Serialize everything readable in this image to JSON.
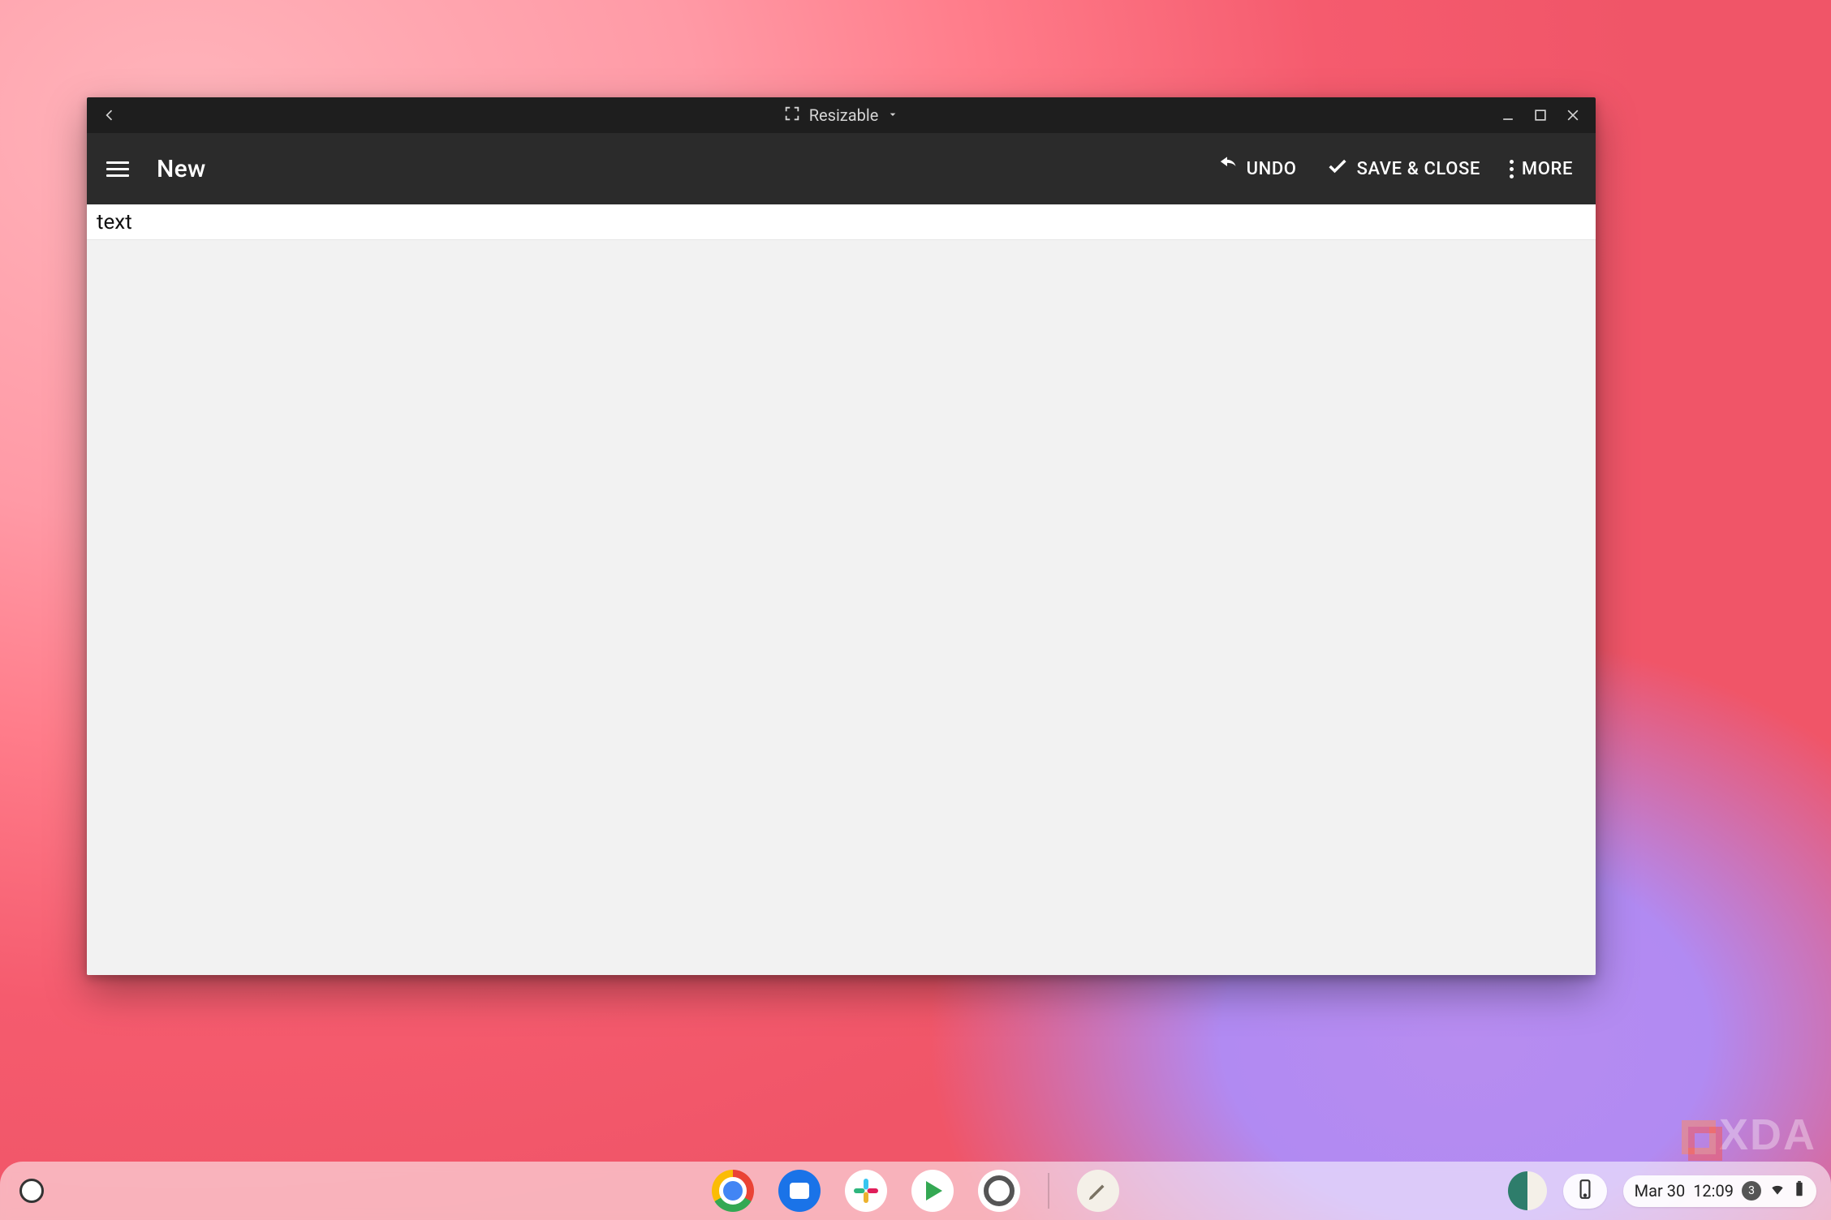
{
  "window": {
    "titlebar": {
      "resizable_label": "Resizable"
    },
    "toolbar": {
      "title": "New",
      "undo_label": "UNDO",
      "save_close_label": "SAVE & CLOSE",
      "more_label": "MORE"
    },
    "editor": {
      "first_line": "text"
    }
  },
  "shelf": {
    "apps": [
      {
        "name": "chrome"
      },
      {
        "name": "files"
      },
      {
        "name": "slack"
      },
      {
        "name": "play-store"
      },
      {
        "name": "settings"
      },
      {
        "name": "text-editor"
      }
    ],
    "status": {
      "date": "Mar 30",
      "time": "12:09",
      "notification_count": "3"
    }
  },
  "watermark": {
    "text": "XDA"
  }
}
